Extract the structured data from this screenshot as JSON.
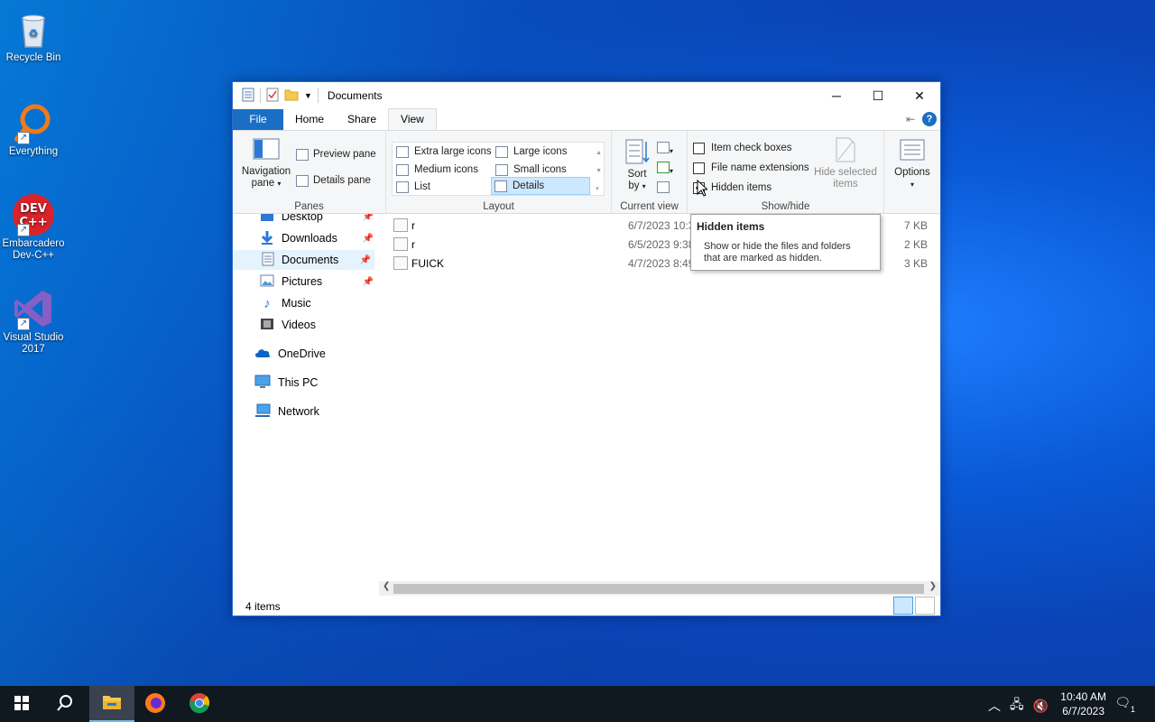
{
  "desktop": {
    "icons": [
      {
        "label": "Recycle Bin"
      },
      {
        "label": "Everything"
      },
      {
        "label": "Embarcadero Dev-C++"
      },
      {
        "label": "Visual Studio 2017"
      }
    ]
  },
  "window": {
    "title": "Documents",
    "tabs": [
      "File",
      "Home",
      "Share",
      "View"
    ],
    "active_tab": "View",
    "ribbon": {
      "panes": {
        "label": "Panes",
        "navigation_pane": "Navigation",
        "navigation_pane_2": "pane",
        "preview_pane": "Preview pane",
        "details_pane": "Details pane"
      },
      "layout": {
        "label": "Layout",
        "items": [
          "Extra large icons",
          "Large icons",
          "Medium icons",
          "Small icons",
          "List",
          "Details"
        ],
        "selected": "Details"
      },
      "current_view": {
        "label": "Current view",
        "sort_by_1": "Sort",
        "sort_by_2": "by"
      },
      "show_hide": {
        "label": "Show/hide",
        "item_check_boxes": "Item check boxes",
        "file_name_extensions": "File name extensions",
        "hidden_items": "Hidden items",
        "hidden_items_checked": true,
        "hide_selected_1": "Hide selected",
        "hide_selected_2": "items"
      },
      "options": {
        "label": "Options"
      }
    },
    "nav": [
      {
        "label": "Desktop"
      },
      {
        "label": "Downloads"
      },
      {
        "label": "Documents"
      },
      {
        "label": "Pictures"
      },
      {
        "label": "Music"
      },
      {
        "label": "Videos"
      },
      {
        "label": "OneDrive"
      },
      {
        "label": "This PC"
      },
      {
        "label": "Network"
      }
    ],
    "files": [
      {
        "name": "r",
        "date": "6/7/2023 10:3",
        "size": "7 KB"
      },
      {
        "name": "r",
        "date": "6/5/2023 9:38",
        "size": "2 KB"
      },
      {
        "name": "FUICK",
        "date": "4/7/2023 8:49",
        "size": "3 KB"
      }
    ],
    "status": "4 items"
  },
  "tooltip": {
    "title": "Hidden items",
    "body_1": "Show or hide the files and folders",
    "body_2": "that are marked as hidden."
  },
  "taskbar": {
    "time": "10:40 AM",
    "date": "6/7/2023",
    "notification_count": "1"
  }
}
